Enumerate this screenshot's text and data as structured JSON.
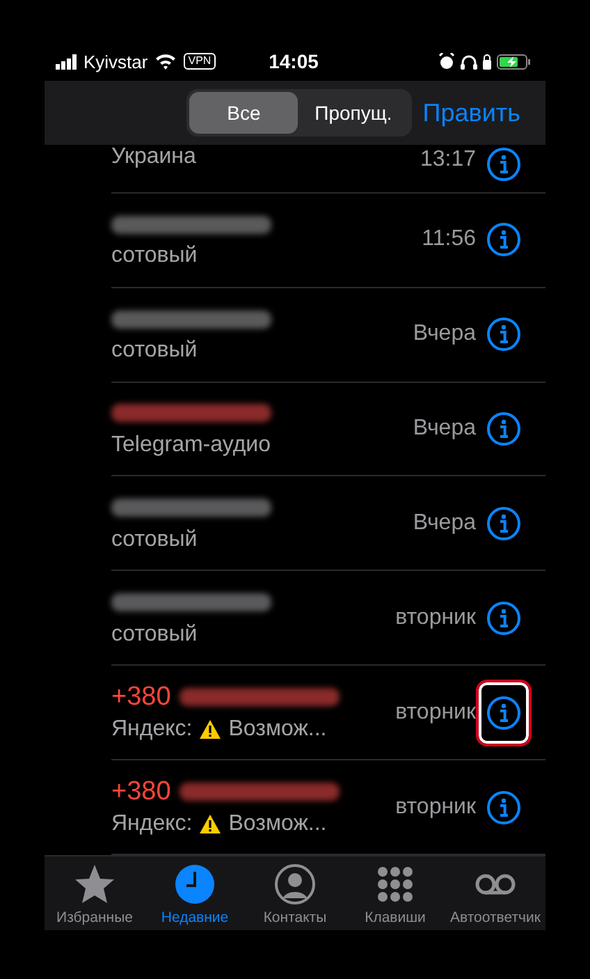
{
  "status_bar": {
    "carrier": "Kyivstar",
    "vpn": "VPN",
    "time": "14:05"
  },
  "header": {
    "segments": [
      {
        "label": "Все",
        "selected": true
      },
      {
        "label": "Пропущ.",
        "selected": false
      }
    ],
    "edit": "Править"
  },
  "calls": [
    {
      "subtitle": "Украина",
      "time": "13:17"
    },
    {
      "missed": false,
      "subtitle": "сотовый",
      "time": "11:56"
    },
    {
      "missed": false,
      "subtitle": "сотовый",
      "time": "Вчера"
    },
    {
      "missed": true,
      "subtitle": "Telegram-аудио",
      "time": "Вчера"
    },
    {
      "missed": false,
      "subtitle": "сотовый",
      "time": "Вчера"
    },
    {
      "missed": false,
      "subtitle": "сотовый",
      "time": "вторник"
    },
    {
      "missed": true,
      "number_prefix": "+380",
      "subtitle": "Яндекс:",
      "warning": true,
      "detail": "Возмож...",
      "time": "вторник",
      "highlighted": true
    },
    {
      "missed": true,
      "number_prefix": "+380",
      "subtitle": "Яндекс:",
      "warning": true,
      "detail": "Возмож...",
      "time": "вторник"
    }
  ],
  "tab_bar": [
    {
      "kind": "star",
      "label": "Избранные",
      "selected": false
    },
    {
      "kind": "clock",
      "label": "Недавние",
      "selected": true
    },
    {
      "kind": "person",
      "label": "Контакты",
      "selected": false
    },
    {
      "kind": "keypad",
      "label": "Клавиши",
      "selected": false
    },
    {
      "kind": "voicemail",
      "label": "Автоответчик",
      "selected": false
    }
  ]
}
